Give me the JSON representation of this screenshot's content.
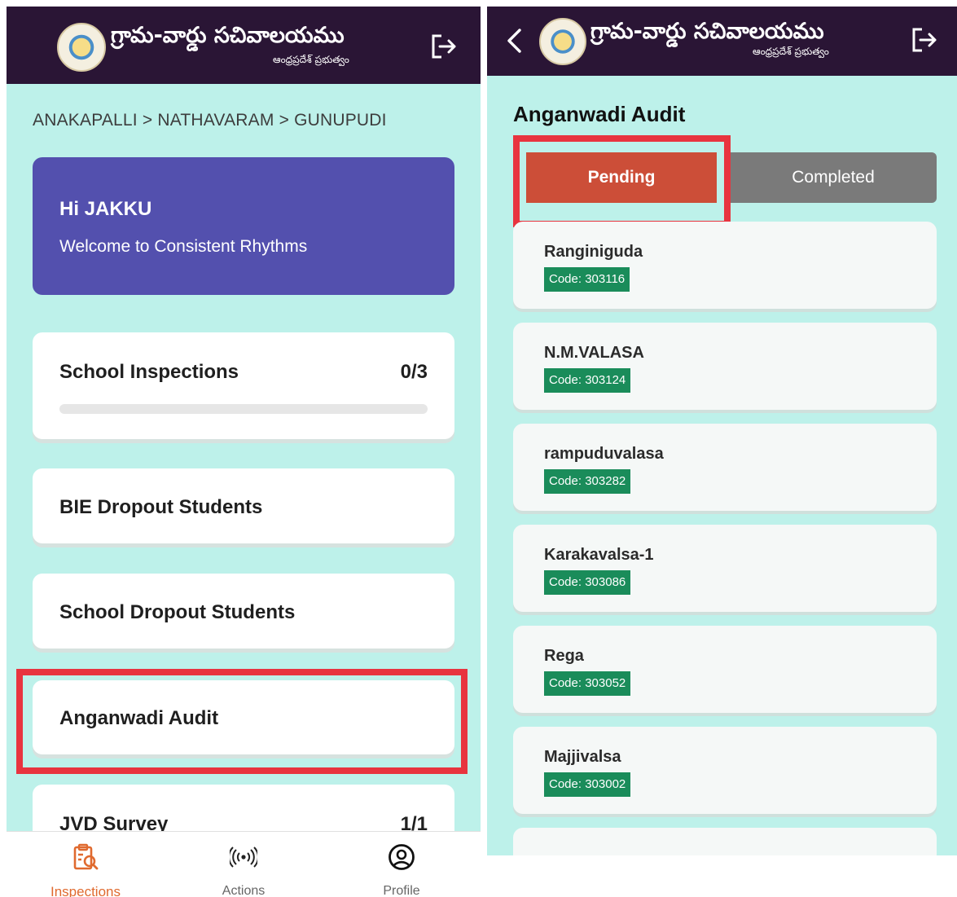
{
  "app": {
    "title_telugu": "గ్రామ-వార్డు సచివాలయము",
    "subtitle_telugu": "ఆంధ్రప్రదేశ్ ప్రభుత్వం"
  },
  "left": {
    "breadcrumb": "ANAKAPALLI > NATHAVARAM > GUNUPUDI",
    "welcome": {
      "greeting": "Hi JAKKU",
      "message": "Welcome to Consistent Rhythms"
    },
    "menu": [
      {
        "label": "School Inspections",
        "count": "0/3",
        "progress": 0
      },
      {
        "label": "BIE Dropout Students"
      },
      {
        "label": "School Dropout Students"
      },
      {
        "label": "Anganwadi Audit"
      },
      {
        "label": "JVD Survey",
        "count": "1/1"
      }
    ],
    "bottom_nav": [
      {
        "label": "Inspections",
        "icon": "inspections-icon",
        "active": true
      },
      {
        "label": "Actions",
        "icon": "broadcast-icon"
      },
      {
        "label": "Profile",
        "icon": "profile-icon"
      }
    ]
  },
  "right": {
    "page_title": "Anganwadi Audit",
    "tabs": [
      {
        "label": "Pending",
        "active": true
      },
      {
        "label": "Completed"
      }
    ],
    "centers": [
      {
        "name": "Ranginiguda",
        "code": "Code: 303116"
      },
      {
        "name": "N.M.VALASA",
        "code": "Code: 303124"
      },
      {
        "name": "rampuduvalasa",
        "code": "Code: 303282"
      },
      {
        "name": "Karakavalsa-1",
        "code": "Code: 303086"
      },
      {
        "name": "Rega",
        "code": "Code: 303052"
      },
      {
        "name": "Majjivalsa",
        "code": "Code: 303002"
      }
    ]
  },
  "colors": {
    "header": "#2a1535",
    "background": "#bdf1ea",
    "welcome_card": "#5350ae",
    "pending_tab": "#cc4e38",
    "completed_tab": "#7a7a7a",
    "code_badge": "#1a8c5a",
    "highlight": "#e8343f",
    "active_nav": "#e06a2f"
  }
}
